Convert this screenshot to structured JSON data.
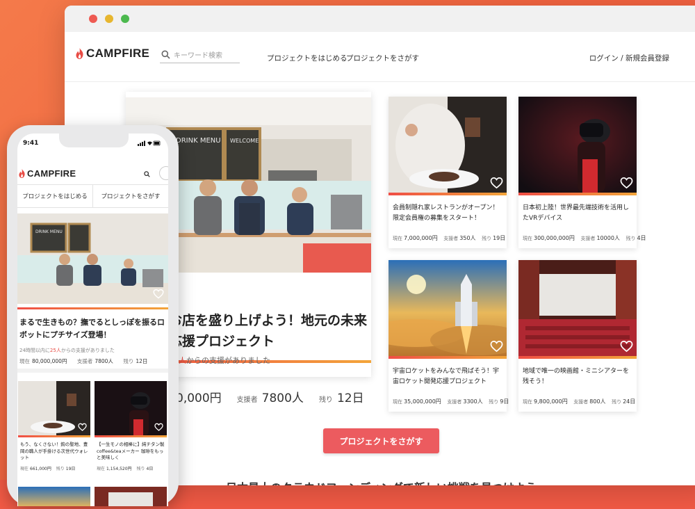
{
  "brand": {
    "name": "CAMPFIRE",
    "color": "#e84c45"
  },
  "desktop": {
    "search_placeholder": "キーワード検索",
    "nav": {
      "start": "プロジェクトをはじめる",
      "find": "プロジェクトをさがす"
    },
    "auth": "ログイン / 新規会員登録",
    "featured": {
      "title": "お店を盛り上げよう！地元の未来応援プロジェクト",
      "supporters_count": "23人",
      "supporters_suffix": "からの支援がありました",
      "amount": "0,000円",
      "supporters_label": "支援者",
      "supporters": "7800人",
      "remaining_label": "残り",
      "remaining": "12日"
    },
    "cards": [
      {
        "title": "会員制隠れ家レストランがオープン！限定会員権の募集をスタート！",
        "now_label": "現在",
        "amount": "7,000,000円",
        "sup_label": "支援者",
        "supporters": "350人",
        "rem_label": "残り",
        "remaining": "19日"
      },
      {
        "title": "日本初上陸！世界最先端技術を活用したVRデバイス",
        "now_label": "現在",
        "amount": "300,000,000円",
        "sup_label": "支援者",
        "supporters": "10000人",
        "rem_label": "残り",
        "remaining": "4日"
      },
      {
        "title": "宇宙ロケットをみんなで飛ばそう！宇宙ロケット開発応援プロジェクト",
        "now_label": "現在",
        "amount": "35,000,000円",
        "sup_label": "支援者",
        "supporters": "3300人",
        "rem_label": "残り",
        "remaining": "9日"
      },
      {
        "title": "地域で唯一の映画館・ミニシアターを残そう！",
        "now_label": "現在",
        "amount": "9,800,000円",
        "sup_label": "支援者",
        "supporters": "800人",
        "rem_label": "残り",
        "remaining": "24日"
      }
    ],
    "cta": "プロジェクトをさがす",
    "tagline": "日本最大のクラウドファンディングで新しい挑戦を見つけよう"
  },
  "mobile": {
    "time": "9:41",
    "tabs": {
      "start": "プロジェクトをはじめる",
      "find": "プロジェクトをさがす"
    },
    "featured": {
      "title": "まるで生きもの？撫でるとしっぽを振るロボットにプチサイズ登場！",
      "sub_prefix": "24時間以内に",
      "sub_count": "25人",
      "sub_suffix": "からの支援がありました",
      "now_label": "現在",
      "amount": "80,000,000円",
      "sup_label": "支援者",
      "supporters": "7800人",
      "rem_label": "残り",
      "remaining": "12日"
    },
    "cards": [
      {
        "title": "もう、なくさない！鉤の聖地、豊岡の職人が手掛ける次世代ウォレット",
        "now_label": "現在",
        "amount": "661,000円",
        "rem_label": "残り",
        "remaining": "19日"
      },
      {
        "title": "【一生モノの相棒に】純チタン製coffee&teaメーカー 珈琲をもっと美味しく",
        "now_label": "現在",
        "amount": "1,154,520円",
        "rem_label": "残り",
        "remaining": "4日"
      }
    ]
  }
}
